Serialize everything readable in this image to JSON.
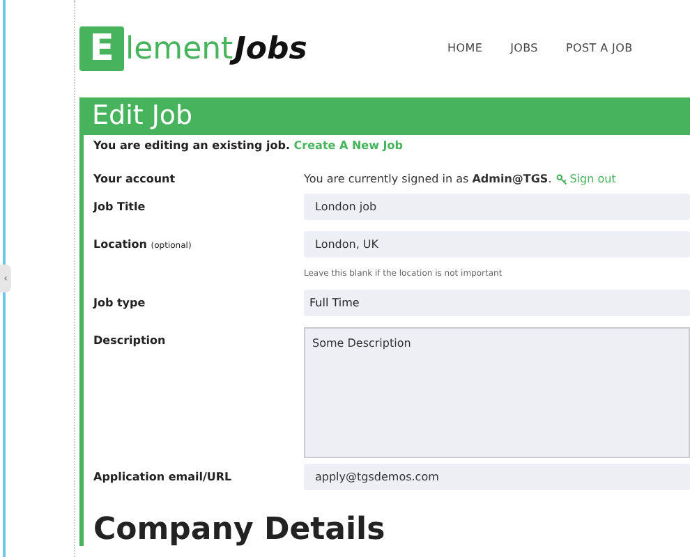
{
  "collapse_tab": {
    "glyph": "‹"
  },
  "logo": {
    "mark": "E",
    "word": "lement",
    "suffix": "Jobs"
  },
  "nav": [
    {
      "label": "HOME"
    },
    {
      "label": "JOBS"
    },
    {
      "label": "POST A JOB"
    }
  ],
  "form": {
    "title": "Edit Job",
    "notice": "You are editing an existing job.",
    "notice_link": "Create A New Job",
    "account": {
      "label": "Your account",
      "text": "You are currently signed in as **Admin@TGS**.",
      "link": "Sign out"
    },
    "fields": [
      {
        "kind": "input",
        "label": "Job Title",
        "value": "London job"
      },
      {
        "kind": "input",
        "label": "Location",
        "note": "(optional)",
        "value": "London, UK",
        "hint": "Leave this blank if the location is not important"
      },
      {
        "kind": "select",
        "label": "Job type",
        "value": "Full Time"
      },
      {
        "kind": "textarea",
        "label": "Description",
        "value": "Some Description"
      },
      {
        "kind": "input",
        "label": "Application email/URL",
        "value": "apply@tgsdemos.com"
      }
    ],
    "section_heading": "Company Details"
  }
}
